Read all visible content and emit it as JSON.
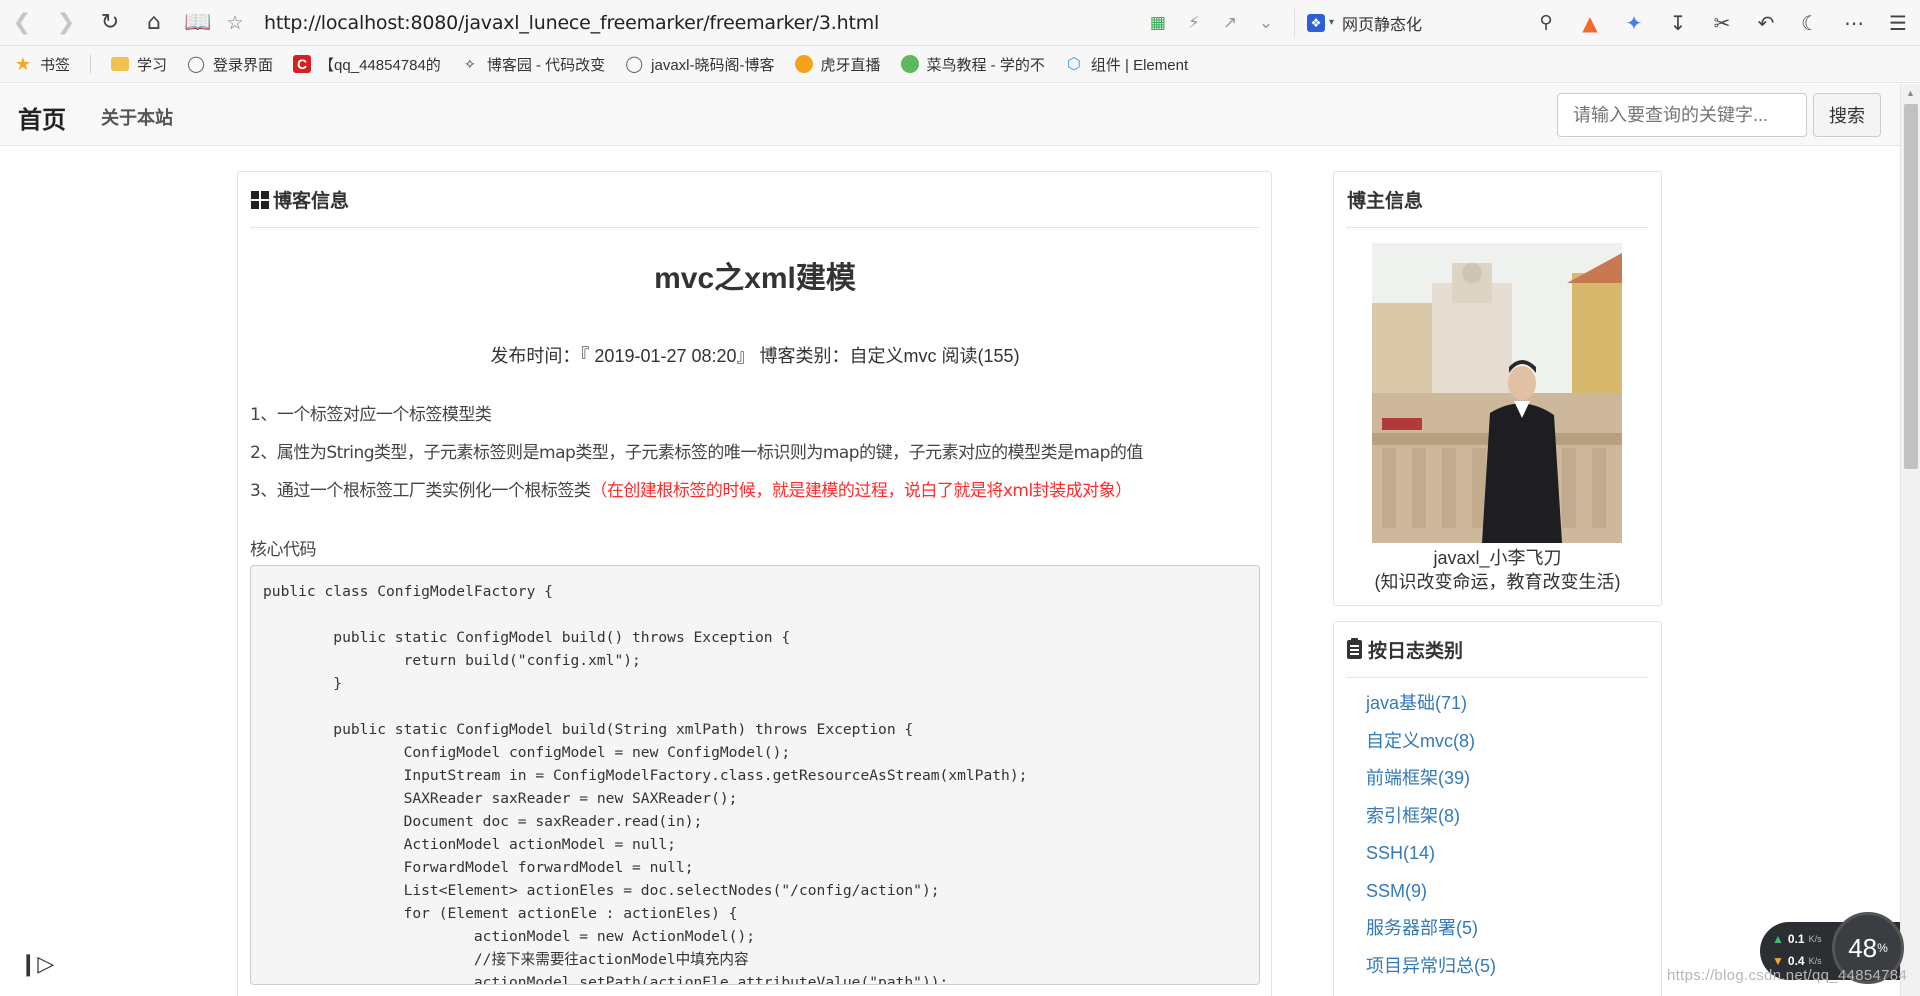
{
  "browser": {
    "url": "http://localhost:8080/javaxl_lunece_freemarker/freemarker/3.html",
    "search_engine_label": "网页静态化"
  },
  "bookmarks": [
    {
      "label": "书签",
      "icon": "star-icon",
      "color": "#f5a623"
    },
    {
      "label": "学习",
      "icon": "folder-icon",
      "color": "#f2c14e"
    },
    {
      "label": "登录界面",
      "icon": "globe-icon",
      "color": "#666666"
    },
    {
      "label": "【qq_44854784的",
      "icon": "csdn-logo-icon",
      "color": "#d71f1f"
    },
    {
      "label": "博客园 - 代码改变",
      "icon": "cnblogs-logo-icon",
      "color": "#333333"
    },
    {
      "label": "javaxl-晓码阁-博客",
      "icon": "globe-icon",
      "color": "#666666"
    },
    {
      "label": "虎牙直播",
      "icon": "huya-logo-icon",
      "color": "#f7a21b"
    },
    {
      "label": "菜鸟教程 - 学的不",
      "icon": "runoob-logo-icon",
      "color": "#5cb85c"
    },
    {
      "label": "组件 | Element",
      "icon": "element-logo-icon",
      "color": "#409eff"
    }
  ],
  "nav": {
    "home": "首页",
    "about": "关于本站",
    "search_placeholder": "请输入要查询的关键字...",
    "search_button": "搜索"
  },
  "blog": {
    "heading": "博客信息",
    "title": "mvc之xml建模",
    "meta": "发布时间：『 2019-01-27 08:20』  博客类别：自定义mvc  阅读(155)",
    "items": [
      {
        "text": "1、一个标签对应一个标签模型类",
        "highlight": ""
      },
      {
        "text": "2、属性为String类型，子元素标签则是map类型，子元素标签的唯一标识则为map的键，子元素对应的模型类是map的值",
        "highlight": ""
      },
      {
        "text": "3、通过一个根标签工厂类实例化一个根标签类",
        "highlight": "（在创建根标签的时候，就是建模的过程，说白了就是将xml封装成对象）"
      }
    ],
    "core_code_label": "核心代码",
    "code": "public class ConfigModelFactory {\n\n        public static ConfigModel build() throws Exception {\n                return build(\"config.xml\");\n        }\n\n        public static ConfigModel build(String xmlPath) throws Exception {\n                ConfigModel configModel = new ConfigModel();\n                InputStream in = ConfigModelFactory.class.getResourceAsStream(xmlPath);\n                SAXReader saxReader = new SAXReader();\n                Document doc = saxReader.read(in);\n                ActionModel actionModel = null;\n                ForwardModel forwardModel = null;\n                List<Element> actionEles = doc.selectNodes(\"/config/action\");\n                for (Element actionEle : actionEles) {\n                        actionModel = new ActionModel();\n                        //接下来需要往actionModel中填充内容\n                        actionModel.setPath(actionEle.attributeValue(\"path\"));"
  },
  "author": {
    "heading": "博主信息",
    "name": "javaxl_小李飞刀",
    "motto": "(知识改变命运，教育改变生活)"
  },
  "categories": {
    "heading": "按日志类别",
    "items": [
      "java基础(71)",
      "自定义mvc(8)",
      "前端框架(39)",
      "索引框架(8)",
      "SSH(14)",
      "SSM(9)",
      "服务器部署(5)",
      "项目异常归总(5)"
    ]
  },
  "network_widget": {
    "upload": "0.1",
    "download": "0.4",
    "unit": "K/s",
    "percent": "48",
    "percent_unit": "%"
  },
  "watermark": "https://blog.csdn.net/qq_44854784",
  "colors": {
    "link": "#337ab7",
    "highlight_red": "#ff2b2b",
    "toolbar_bg": "#f7f7f7"
  }
}
